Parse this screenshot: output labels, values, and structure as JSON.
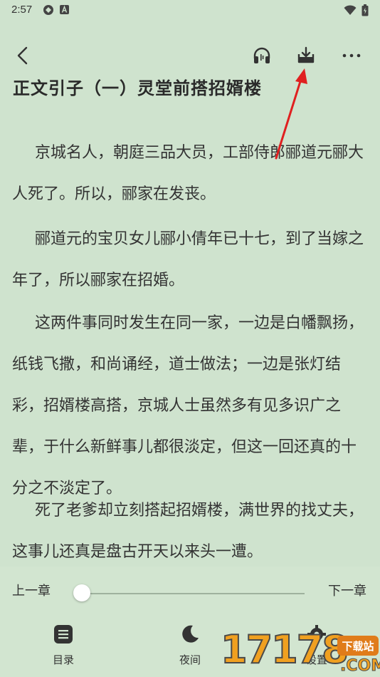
{
  "status_bar": {
    "time": "2:57"
  },
  "toolbar": {
    "back": "back",
    "listen": "listen",
    "download": "download",
    "more": "more"
  },
  "chapter": {
    "title": "正文引子（一）灵堂前搭招婿楼",
    "paragraphs": [
      {
        "lines": [
          "京城名人，朝庭三品大员，工部侍郎郦道元郦大",
          "人死了。所以，郦家在发丧。"
        ]
      },
      {
        "lines": [
          "郦道元的宝贝女儿郦小倩年已十七，到了当嫁之",
          "年了，所以郦家在招婚。"
        ]
      },
      {
        "lines": [
          "这两件事同时发生在同一家，一边是白幡飘扬，",
          "纸钱飞撒，和尚诵经，道士做法；一边是张灯结",
          "彩，招婿楼高搭，京城人士虽然多有见多识广之",
          "辈，于什么新鲜事儿都很淡定，但这一回还真的十",
          "分之不淡定了。"
        ]
      },
      {
        "lines": [
          "死了老爹却立刻搭起招婿楼，满世界的找丈夫，",
          "这事儿还真是盘古开天以来头一遭。"
        ]
      }
    ]
  },
  "progress": {
    "prev_label": "上一章",
    "next_label": "下一章",
    "value": 0
  },
  "tabs": [
    {
      "label": "目录",
      "icon": "menu-list-icon"
    },
    {
      "label": "夜间",
      "icon": "moon-icon"
    },
    {
      "label": "设置",
      "icon": "gear-icon"
    }
  ],
  "watermark": {
    "number": "17178",
    "badge": "下载站",
    "suffix": ".COM"
  },
  "colors": {
    "background": "#cfe3ce",
    "arrow": "#e02020",
    "text": "#333333"
  }
}
